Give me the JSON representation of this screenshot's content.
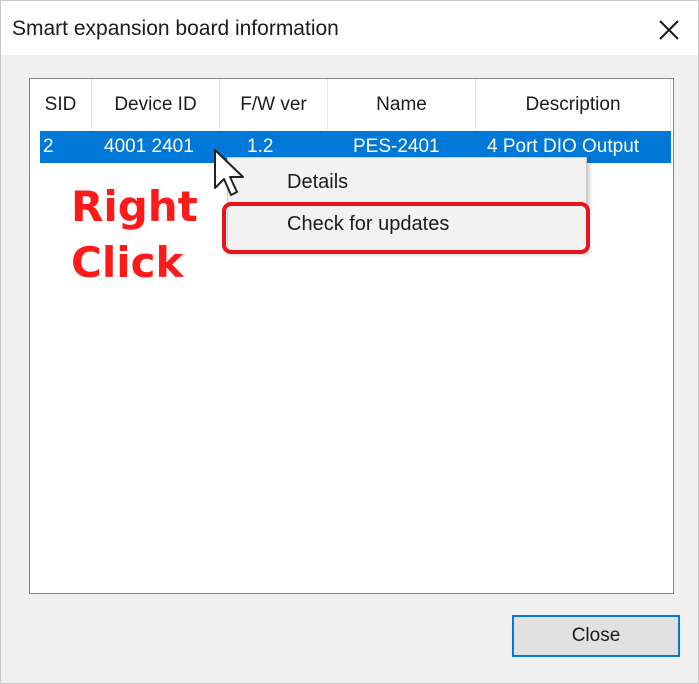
{
  "window": {
    "title": "Smart expansion board information",
    "close_icon": "close-icon"
  },
  "table": {
    "columns": [
      "SID",
      "Device ID",
      "F/W ver",
      "Name",
      "Description"
    ],
    "rows": [
      {
        "sid": "2",
        "device_id": "4001 2401",
        "fw_ver": "1.2",
        "name": "PES-2401",
        "description": "4 Port DIO Output",
        "selected": true
      }
    ]
  },
  "context_menu": {
    "items": [
      "Details",
      "Check for updates"
    ],
    "highlighted_item": "Check for updates"
  },
  "annotation": {
    "line1": "Right",
    "line2": "Click",
    "color": "#ff1a1a"
  },
  "buttons": {
    "close_label": "Close"
  },
  "colors": {
    "selection": "#0078d7",
    "highlight_border": "#e8141c",
    "dialog_bg": "#f0f0f0"
  }
}
